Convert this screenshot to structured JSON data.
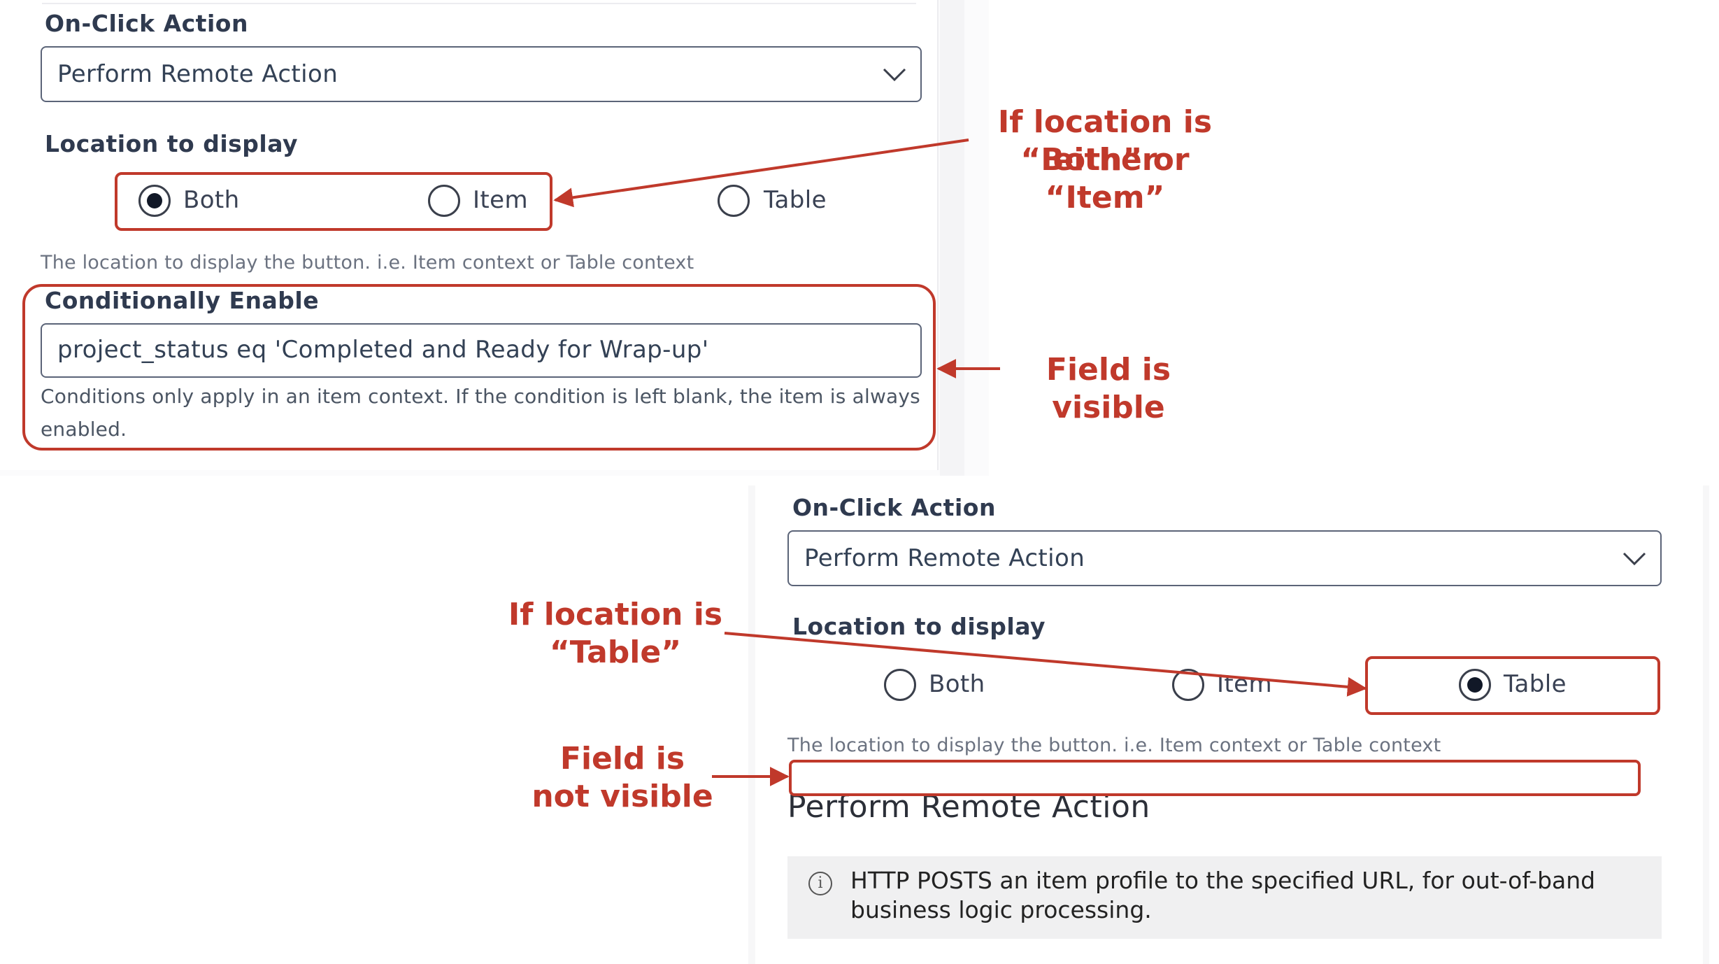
{
  "top_panel": {
    "on_click_label": "On-Click Action",
    "on_click_value": "Perform Remote Action",
    "location_label": "Location to display",
    "radios": [
      {
        "label": "Both",
        "checked": true
      },
      {
        "label": "Item",
        "checked": false
      },
      {
        "label": "Table",
        "checked": false
      }
    ],
    "location_help": "The location to display the button. i.e. Item context or Table context",
    "conditional_label": "Conditionally Enable",
    "conditional_value": "project_status eq 'Completed and Ready for Wrap-up'",
    "conditional_help_line1": "Conditions only apply in an item context. If the condition is left blank, the item is always",
    "conditional_help_line2": "enabled."
  },
  "bottom_panel": {
    "on_click_label": "On-Click Action",
    "on_click_value": "Perform Remote Action",
    "location_label": "Location to display",
    "radios": [
      {
        "label": "Both",
        "checked": false
      },
      {
        "label": "Item",
        "checked": false
      },
      {
        "label": "Table",
        "checked": true
      }
    ],
    "location_help": "The location to display the button. i.e. Item context or Table context",
    "section_heading": "Perform Remote Action",
    "info_line1": "HTTP POSTS an item profile to the specified URL, for out-of-band",
    "info_line2": "business logic processing."
  },
  "annotations": {
    "either_line1": "If location is either",
    "either_line2": "“Both” or “Item”",
    "visible": "Field is visible",
    "table_line1": "If location is",
    "table_line2": "“Table”",
    "not_visible_line1": "Field is",
    "not_visible_line2": "not visible"
  },
  "colors": {
    "annotation_red": "#c0392b",
    "text_dark": "#2f3a4f",
    "help_gray": "#6b7280"
  },
  "icons": [
    "chevron-down-icon",
    "info-icon",
    "arrow-icon"
  ]
}
